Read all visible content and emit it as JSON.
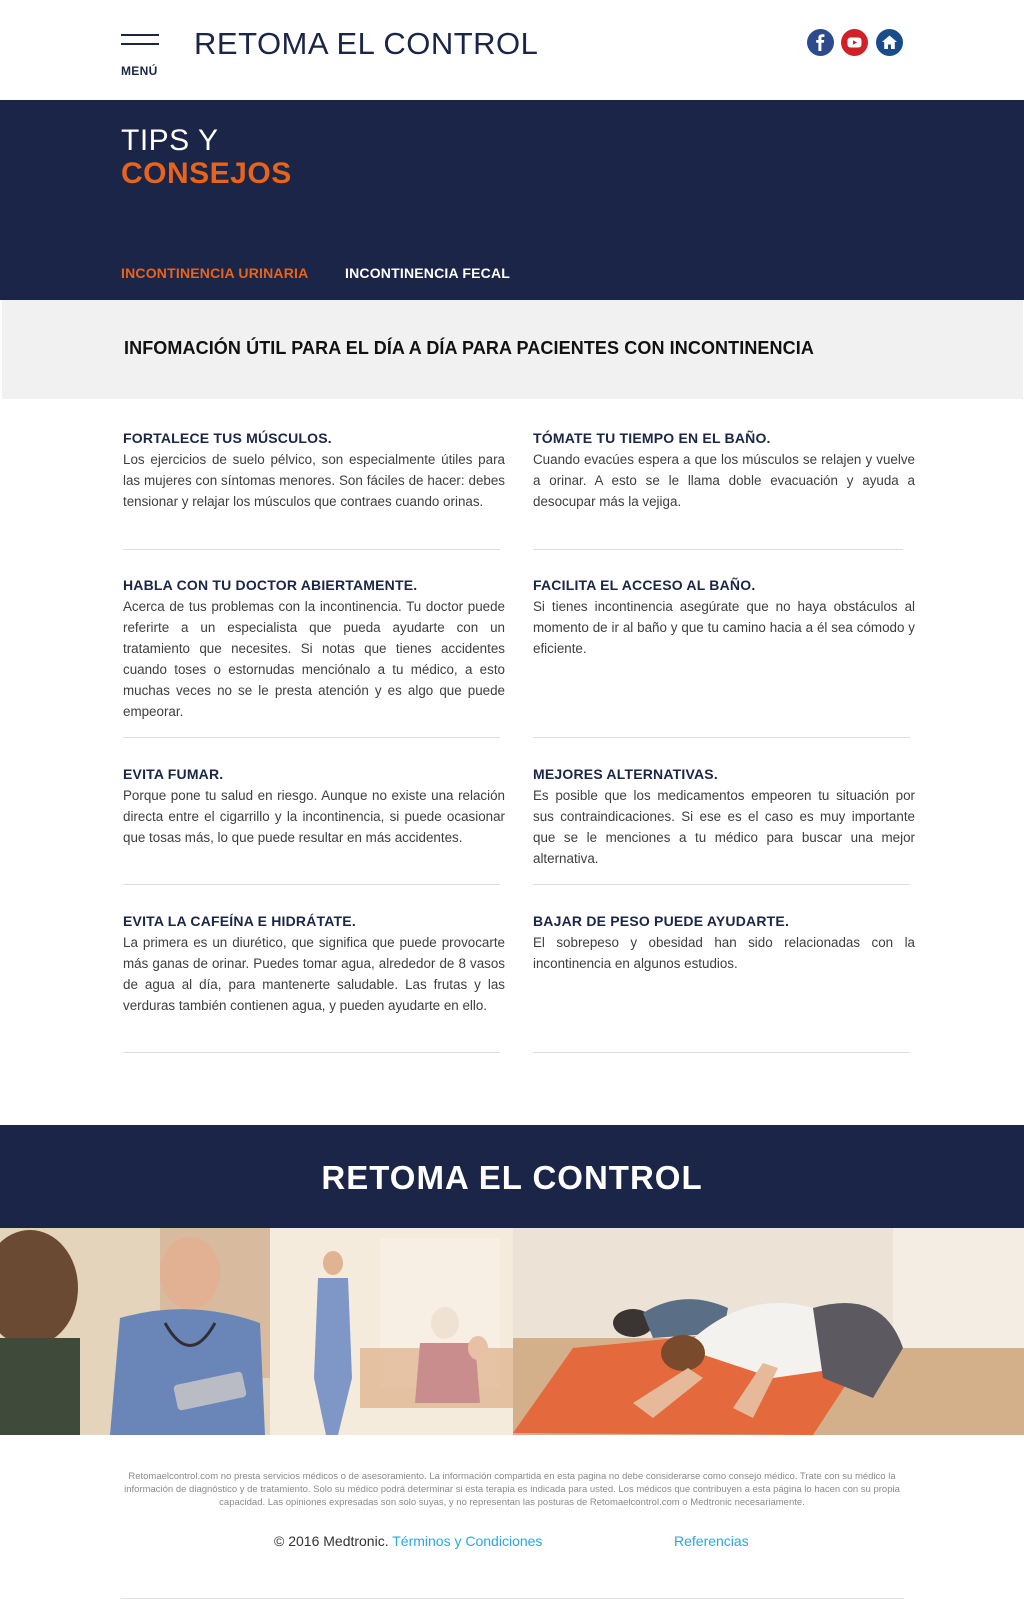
{
  "header": {
    "menu_label": "MENÚ",
    "brand": "RETOMA EL CONTROL",
    "social_icons": [
      "facebook-icon",
      "youtube-icon",
      "home-icon"
    ]
  },
  "hero": {
    "line1": "TIPS Y",
    "line2": "CONSEJOS",
    "tabs": [
      {
        "label": "INCONTINENCIA URINARIA",
        "active": true
      },
      {
        "label": "INCONTINENCIA FECAL",
        "active": false
      }
    ]
  },
  "band": {
    "title": "INFOMACIÓN ÚTIL PARA EL DÍA A DÍA PARA PACIENTES CON INCONTINENCIA"
  },
  "tips": [
    {
      "title": "FORTALECE TUS MÚSCULOS.",
      "text": "Los ejercicios de suelo pélvico, son especialmente útiles para las mujeres con síntomas menores. Son fáciles de hacer: debes tensionar y relajar los músculos que contraes cuando orinas."
    },
    {
      "title": "TÓMATE TU TIEMPO EN EL BAÑO.",
      "text": "Cuando evacúes espera a que los músculos se relajen y vuelve a orinar. A esto se le llama doble evacuación y ayuda a desocupar más la vejiga."
    },
    {
      "title": "HABLA CON TU DOCTOR ABIERTAMENTE.",
      "text": "Acerca de tus problemas con la incontinencia. Tu doctor puede referirte a un especialista que pueda ayudarte con un tratamiento que necesites. Si notas que tienes accidentes cuando toses o estornudas menciónalo a tu médico, a esto muchas veces no se le presta atención y es algo que puede empeorar."
    },
    {
      "title": "FACILITA EL ACCESO AL BAÑO.",
      "text": "Si tienes incontinencia asegúrate que no haya obstáculos al momento de ir al baño y que tu camino hacia a él sea cómodo y eficiente."
    },
    {
      "title": "EVITA FUMAR.",
      "text": "Porque pone tu salud en riesgo. Aunque no existe una relación directa entre el cigarrillo y la incontinencia, si puede ocasionar que tosas más, lo que puede resultar en más accidentes."
    },
    {
      "title": "MEJORES ALTERNATIVAS.",
      "text": "Es posible que los medicamentos empeoren tu situación por sus contraindicaciones. Si ese es el caso es muy importante que se le menciones a tu médico para buscar una mejor alternativa."
    },
    {
      "title": "EVITA LA CAFEÍNA E HIDRÁTATE.",
      "text": "La primera es un diurético, que significa que puede provocarte más ganas de orinar. Puedes tomar agua, alrededor de 8 vasos de agua al día, para mantenerte saludable. Las frutas y las verduras también contienen agua, y pueden ayudarte en ello."
    },
    {
      "title": "BAJAR DE PESO PUEDE AYUDARTE.",
      "text": "El sobrepeso y obesidad han sido relacionadas con la incontinencia en algunos estudios."
    }
  ],
  "footer": {
    "banner_title": "RETOMA EL CONTROL",
    "disclaimer": "Retomaelcontrol.com no presta servicios médicos o de asesoramiento. La información compartida en esta pagina no debe considerarse como consejo médico. Trate con su médico la información de diagnóstico y de tratamiento. Solo su médico podrá determinar si esta terapia es indicada para usted. Los médicos que contribuyen a esta página lo hacen con su propia capacidad. Las opiniones expresadas son solo suyas, y no representan las posturas de Retomaelcontrol.com o Medtronic necesariamente.",
    "copyright": "© 2016 Medtronic.",
    "terms_link": "Términos y Condiciones",
    "refs_link": "Referencias"
  }
}
